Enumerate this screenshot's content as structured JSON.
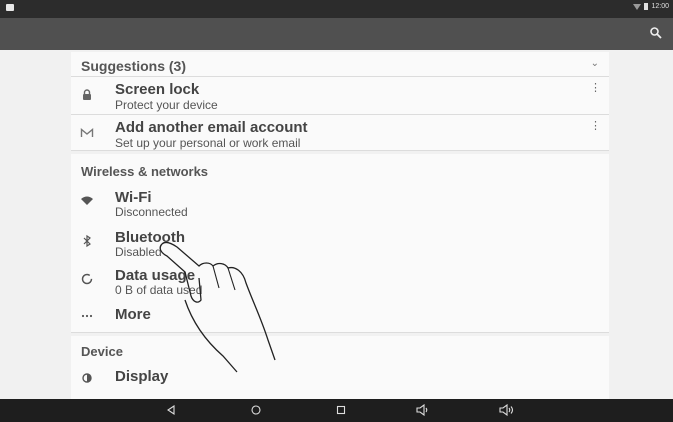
{
  "status_bar": {
    "time": "12:00",
    "icons": [
      "notification-icon",
      "wifi-icon",
      "battery-icon"
    ]
  },
  "app_bar": {
    "icons": [
      "search-icon"
    ]
  },
  "suggestions": {
    "header": "Suggestions (3)",
    "items": [
      {
        "icon": "lock-icon",
        "title": "Screen lock",
        "subtitle": "Protect your device"
      },
      {
        "icon": "gmail-icon",
        "title": "Add another email account",
        "subtitle": "Set up your personal or work email"
      }
    ]
  },
  "wireless": {
    "header": "Wireless & networks",
    "items": [
      {
        "icon": "wifi-icon",
        "title": "Wi-Fi",
        "subtitle": "Disconnected"
      },
      {
        "icon": "bluetooth-icon",
        "title": "Bluetooth",
        "subtitle": "Disabled"
      },
      {
        "icon": "data-usage-icon",
        "title": "Data usage",
        "subtitle": "0 B of data used"
      },
      {
        "icon": "more-icon",
        "title": "More",
        "subtitle": ""
      }
    ]
  },
  "device": {
    "header": "Device",
    "items": [
      {
        "icon": "display-icon",
        "title": "Display"
      }
    ]
  },
  "nav_bar": {
    "icons": [
      "back-icon",
      "home-icon",
      "recents-icon",
      "volume-down-icon",
      "volume-up-icon"
    ]
  }
}
